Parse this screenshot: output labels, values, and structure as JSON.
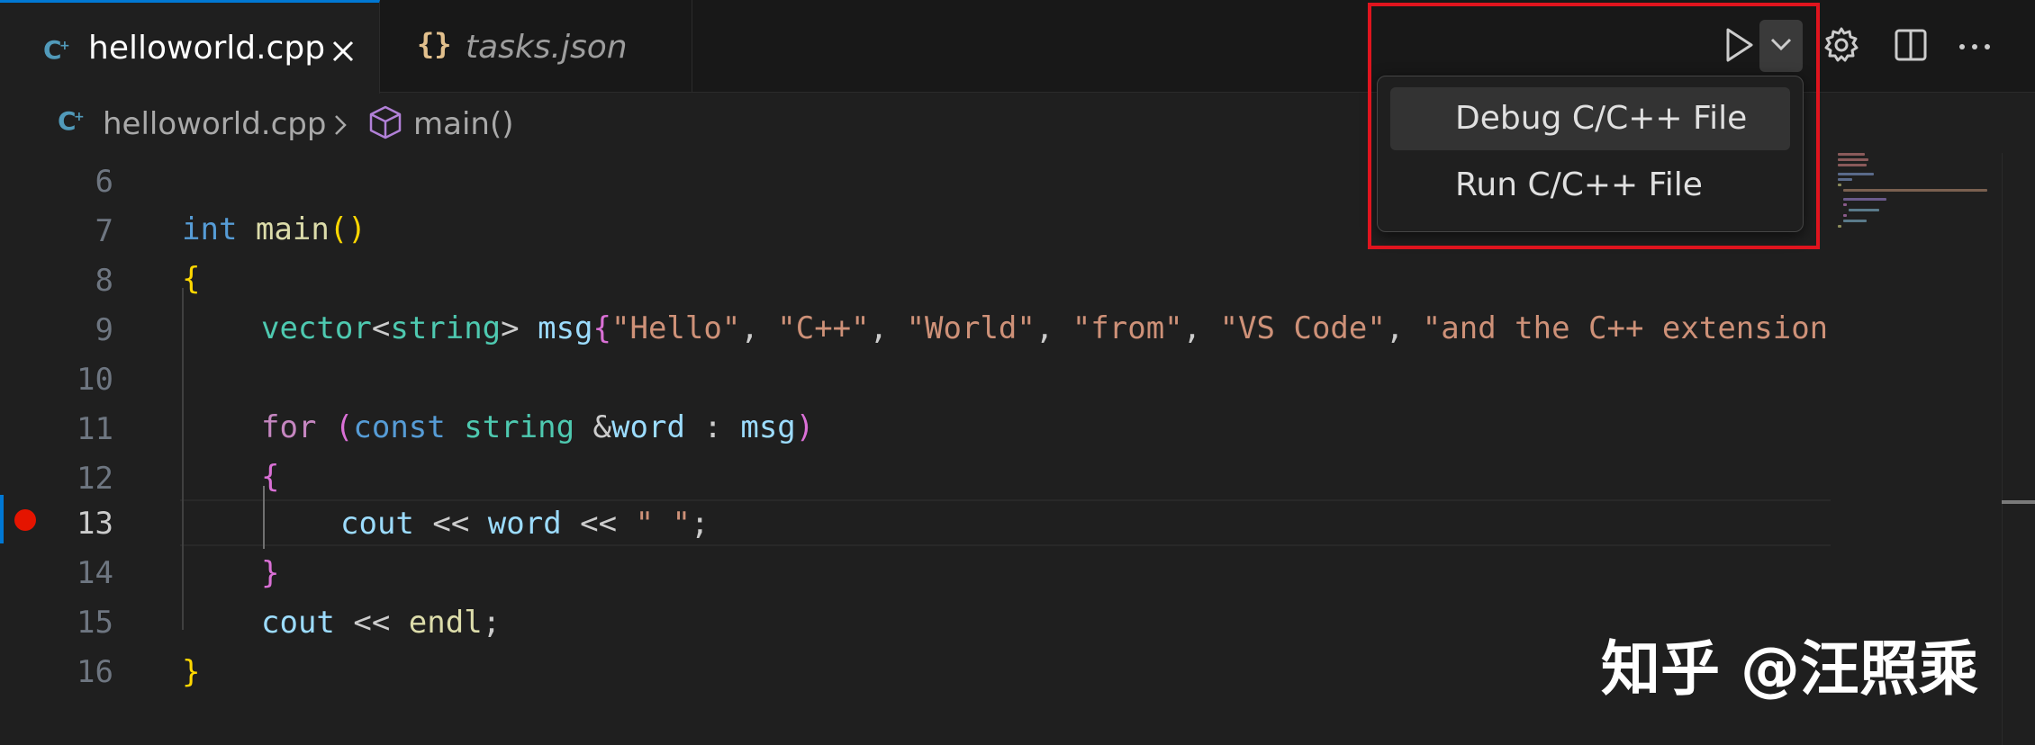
{
  "tabs": [
    {
      "label": "helloworld.cpp",
      "icon": "cpp-file-icon",
      "active": true
    },
    {
      "label": "tasks.json",
      "icon": "json-braces-icon",
      "active": false
    }
  ],
  "tab_json_glyph": "{}",
  "breadcrumb": {
    "file": "helloworld.cpp",
    "symbol": "main()"
  },
  "toolbar": {
    "run_icon": "play-icon",
    "dropdown_icon": "chevron-down-icon",
    "settings_icon": "gear-icon",
    "split_icon": "split-editor-icon",
    "more_icon": "ellipsis-icon"
  },
  "run_menu": {
    "items": [
      "Debug C/C++ File",
      "Run C/C++ File"
    ],
    "highlighted": "Debug C/C++ File"
  },
  "editor": {
    "line_numbers": [
      "6",
      "7",
      "8",
      "9",
      "10",
      "11",
      "12",
      "13",
      "14",
      "15",
      "16"
    ],
    "active_line": "13",
    "breakpoint_line": "13",
    "code": {
      "l7": {
        "kw": "int",
        "fn": "main",
        "open": "(",
        "close": ")"
      },
      "l8": "{",
      "l9": {
        "type1": "vector",
        "lt": "<",
        "type2": "string",
        "gt": ">",
        "var": "msg",
        "ob": "{",
        "s1": "\"Hello\"",
        "s2": "\"C++\"",
        "s3": "\"World\"",
        "s4": "\"from\"",
        "s5": "\"VS Code\"",
        "s6": "\"and the C++ extension!\"",
        "comma": ", "
      },
      "l11": {
        "kw": "for",
        "op": "(",
        "ckw": "const",
        "type": "string",
        "amp": "&",
        "var": "word",
        "colon": " : ",
        "var2": "msg",
        "cp": ")"
      },
      "l12": "{",
      "l13": {
        "v1": "cout",
        "op": " << ",
        "v2": "word",
        "s": "\" \"",
        "semi": ";"
      },
      "l14": "}",
      "l15": {
        "v1": "cout",
        "op": " << ",
        "f": "endl",
        "semi": ";"
      },
      "l16": "}"
    }
  },
  "watermark": "知乎 @汪照乘",
  "colors": {
    "accent": "#0078d4",
    "highlight_border": "#e0141e",
    "breakpoint": "#e51400"
  }
}
